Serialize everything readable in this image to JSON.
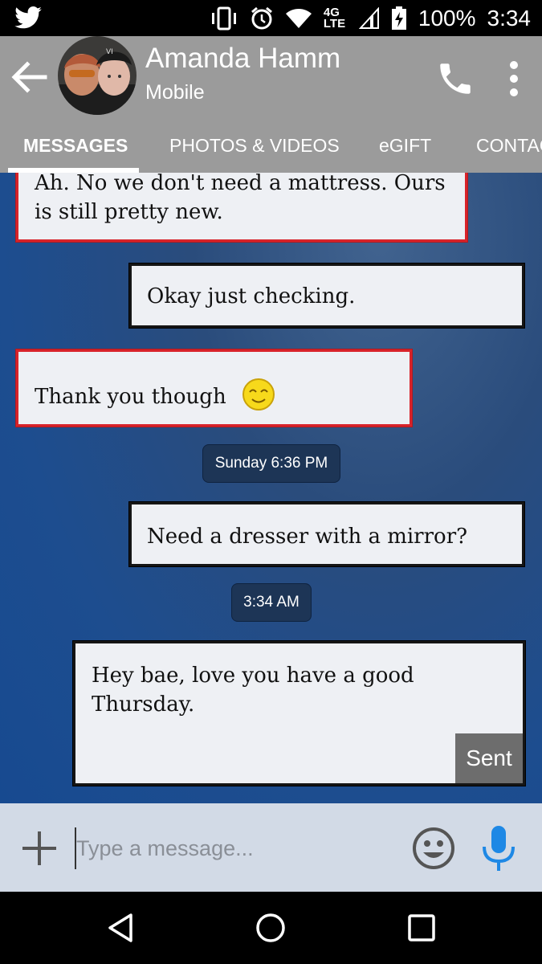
{
  "status_bar": {
    "network": "4G LTE",
    "battery": "100%",
    "time": "3:34"
  },
  "header": {
    "contact_name": "Amanda Hamm",
    "contact_type": "Mobile"
  },
  "tabs": [
    {
      "label": "MESSAGES",
      "active": true
    },
    {
      "label": "PHOTOS & VIDEOS",
      "active": false
    },
    {
      "label": "eGIFT",
      "active": false
    },
    {
      "label": "CONTACT",
      "active": false
    }
  ],
  "messages": [
    {
      "direction": "incoming",
      "lines": [
        "Ah. No we don't need a mattress. Ours",
        "is still pretty new."
      ]
    },
    {
      "direction": "outgoing",
      "lines": [
        "Okay just checking."
      ]
    },
    {
      "direction": "incoming",
      "lines": [
        "Thank you though"
      ],
      "emoji": "smiling-face"
    },
    {
      "timestamp": "Sunday 6:36 PM"
    },
    {
      "direction": "outgoing",
      "lines": [
        "Need a dresser with a mirror?"
      ]
    },
    {
      "timestamp": "3:34 AM"
    },
    {
      "direction": "outgoing",
      "lines": [
        "Hey bae, love you have a good",
        "Thursday."
      ],
      "status": "Sent"
    }
  ],
  "composer": {
    "placeholder": "Type a message..."
  },
  "colors": {
    "app_bar": "#9b9b9b",
    "incoming_border": "#d8232a",
    "outgoing_border": "#151515",
    "conversation_bg": "#1d4d8f",
    "mic_accent": "#1e88e5"
  }
}
